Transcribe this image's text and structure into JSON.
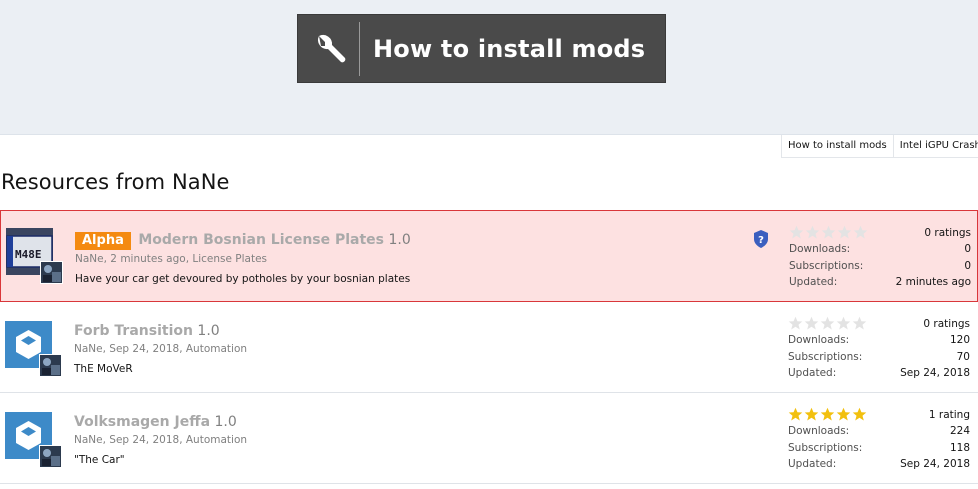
{
  "banner": {
    "label": "How to install mods",
    "icon": "wrench-icon"
  },
  "tabs": [
    {
      "label": "How to install mods"
    },
    {
      "label": "Intel iGPU Crashes"
    }
  ],
  "page_title": "Resources from NaNe",
  "resources": [
    {
      "badge": "Alpha",
      "title": "Modern Bosnian License Plates",
      "version": "1.0",
      "author": "NaNe",
      "date": "2 minutes ago",
      "category": "License Plates",
      "tagline": "Have your car get devoured by potholes by your bosnian plates",
      "rating_text": "0 ratings",
      "stars_filled": 0,
      "downloads_label": "Downloads:",
      "downloads": "0",
      "subscriptions_label": "Subscriptions:",
      "subscriptions": "0",
      "updated_label": "Updated:",
      "updated": "2 minutes ago",
      "highlight": true,
      "avatar": "license-plate-image"
    },
    {
      "badge": "",
      "title": "Forb Transition",
      "version": "1.0",
      "author": "NaNe",
      "date": "Sep 24, 2018",
      "category": "Automation",
      "tagline": "ThE MoVeR",
      "rating_text": "0 ratings",
      "stars_filled": 0,
      "downloads_label": "Downloads:",
      "downloads": "120",
      "subscriptions_label": "Subscriptions:",
      "subscriptions": "70",
      "updated_label": "Updated:",
      "updated": "Sep 24, 2018",
      "highlight": false,
      "avatar": "cube-icon"
    },
    {
      "badge": "",
      "title": "Volksmagen Jeffa",
      "version": "1.0",
      "author": "NaNe",
      "date": "Sep 24, 2018",
      "category": "Automation",
      "tagline": "\"The Car\"",
      "rating_text": "1 rating",
      "stars_filled": 5,
      "downloads_label": "Downloads:",
      "downloads": "224",
      "subscriptions_label": "Subscriptions:",
      "subscriptions": "118",
      "updated_label": "Updated:",
      "updated": "Sep 24, 2018",
      "highlight": false,
      "avatar": "cube-icon"
    }
  ],
  "colors": {
    "badge": "#f48a11",
    "highlight_bg": "#fde1e1",
    "highlight_border": "#d9373a",
    "star_filled": "#f2c00e",
    "star_empty": "#e3e3e3",
    "avatar_blue": "#3d8ac8"
  }
}
